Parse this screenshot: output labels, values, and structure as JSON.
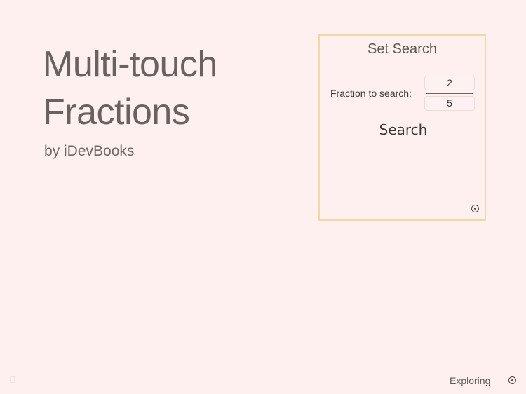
{
  "app": {
    "title_line1": "Multi-touch",
    "title_line2": "Fractions",
    "byline": "by iDevBooks"
  },
  "search_panel": {
    "title": "Set Search",
    "fraction_label": "Fraction to search:",
    "numerator": "2",
    "denominator": "5",
    "search_button": "Search",
    "corner_icon": "target-icon"
  },
  "status_bar": {
    "mode_label": "Exploring",
    "mode_icon": "target-icon"
  },
  "colors": {
    "background": "#fdf0ef",
    "panel_border": "#f0d9a8",
    "text": "#5e5753"
  }
}
